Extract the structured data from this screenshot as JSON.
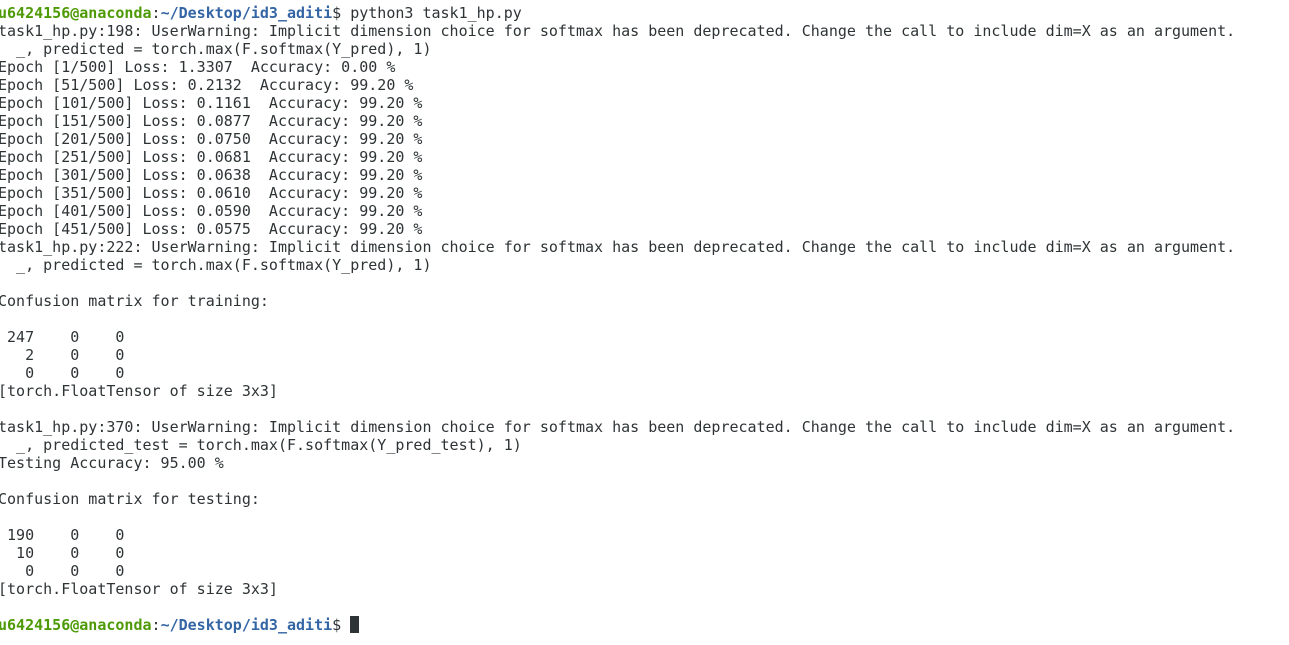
{
  "terminal": {
    "prompt": {
      "user_host": "u6424156@anaconda",
      "sep": ":",
      "path": "~/Desktop/id3_aditi",
      "symbol": "$ "
    },
    "command": "python3 task1_hp.py",
    "lines": [
      "task1_hp.py:198: UserWarning: Implicit dimension choice for softmax has been deprecated. Change the call to include dim=X as an argument.",
      "  _, predicted = torch.max(F.softmax(Y_pred), 1)",
      "Epoch [1/500] Loss: 1.3307  Accuracy: 0.00 %",
      "Epoch [51/500] Loss: 0.2132  Accuracy: 99.20 %",
      "Epoch [101/500] Loss: 0.1161  Accuracy: 99.20 %",
      "Epoch [151/500] Loss: 0.0877  Accuracy: 99.20 %",
      "Epoch [201/500] Loss: 0.0750  Accuracy: 99.20 %",
      "Epoch [251/500] Loss: 0.0681  Accuracy: 99.20 %",
      "Epoch [301/500] Loss: 0.0638  Accuracy: 99.20 %",
      "Epoch [351/500] Loss: 0.0610  Accuracy: 99.20 %",
      "Epoch [401/500] Loss: 0.0590  Accuracy: 99.20 %",
      "Epoch [451/500] Loss: 0.0575  Accuracy: 99.20 %",
      "task1_hp.py:222: UserWarning: Implicit dimension choice for softmax has been deprecated. Change the call to include dim=X as an argument.",
      "  _, predicted = torch.max(F.softmax(Y_pred), 1)",
      "",
      "Confusion matrix for training:",
      "",
      " 247    0    0",
      "   2    0    0",
      "   0    0    0",
      "[torch.FloatTensor of size 3x3]",
      "",
      "task1_hp.py:370: UserWarning: Implicit dimension choice for softmax has been deprecated. Change the call to include dim=X as an argument.",
      "  _, predicted_test = torch.max(F.softmax(Y_pred_test), 1)",
      "Testing Accuracy: 95.00 %",
      "",
      "Confusion matrix for testing:",
      "",
      " 190    0    0",
      "  10    0    0",
      "   0    0    0",
      "[torch.FloatTensor of size 3x3]",
      ""
    ]
  },
  "colors": {
    "background": "#ffffff",
    "text": "#2e3436",
    "user_host": "#4e9a06",
    "path": "#3465a4"
  }
}
